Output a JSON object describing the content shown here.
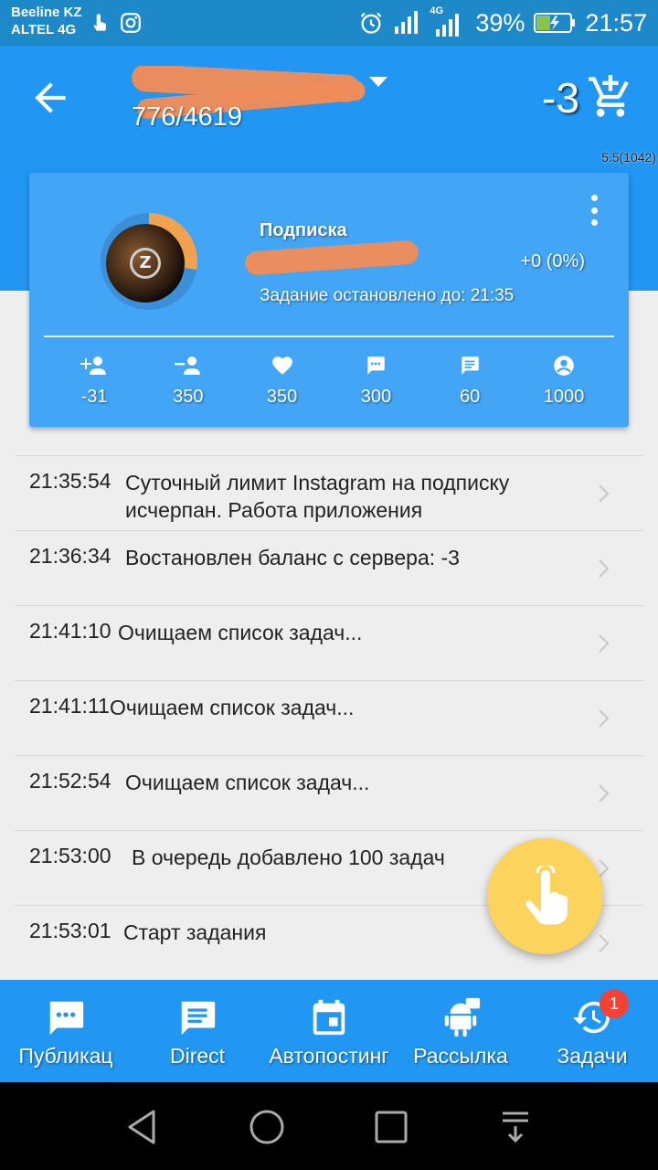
{
  "status_bar": {
    "carrier_1": "Beeline KZ",
    "carrier_2": "ALTEL 4G",
    "network": "4G",
    "battery": "39%",
    "time": "21:57"
  },
  "app_bar": {
    "counter": "776/4619",
    "balance": "-3"
  },
  "version": "5.5(1042)",
  "card": {
    "title": "Подписка",
    "stat": "+0 (0%)",
    "status": "Задание остановлено до: 21:35",
    "limits": [
      {
        "icon": "follow-add-icon",
        "value": "-31"
      },
      {
        "icon": "unfollow-icon",
        "value": "350"
      },
      {
        "icon": "heart-icon",
        "value": "350"
      },
      {
        "icon": "comment-icon",
        "value": "300"
      },
      {
        "icon": "message-icon",
        "value": "60"
      },
      {
        "icon": "profile-circle-icon",
        "value": "1000"
      }
    ]
  },
  "log": [
    {
      "time": "21:35:54",
      "message": "Суточный лимит Instagram на подписку исчерпан. Работа приложения"
    },
    {
      "time": "21:36:34",
      "message": "Востановлен баланс с сервера: -3"
    },
    {
      "time": "21:41:10",
      "message": "Очищаем список задач..."
    },
    {
      "time": "21:41:11",
      "message": "Очищаем список задач..."
    },
    {
      "time": "21:52:54",
      "message": "Очищаем список задач..."
    },
    {
      "time": "21:53:00",
      "message": "В очередь добавлено 100 задач"
    },
    {
      "time": "21:53:01",
      "message": "Старт задания"
    }
  ],
  "bottom_nav": {
    "items": [
      {
        "label": "Публикац"
      },
      {
        "label": "Direct"
      },
      {
        "label": "Автопостинг"
      },
      {
        "label": "Рассылка"
      },
      {
        "label": "Задачи",
        "badge": "1"
      }
    ]
  },
  "colors": {
    "primary": "#2196f3",
    "card": "#42a5f5",
    "fab": "#fbd35d",
    "badge": "#f44336"
  }
}
